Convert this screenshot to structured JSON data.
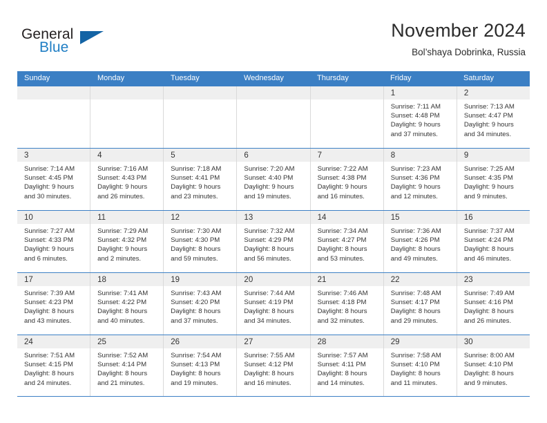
{
  "logo": {
    "word_one": "General",
    "word_two": "Blue",
    "triangle_icon": "triangle-icon",
    "brand_blue": "#1f7ec4",
    "brand_dark_blue": "#1464a5"
  },
  "header": {
    "month_title": "November 2024",
    "location": "Bol’shaya Dobrinka, Russia"
  },
  "colors": {
    "header_band": "#3b7fc4",
    "day_band": "#efefef",
    "cell_border": "#d9d9d9",
    "text": "#333333"
  },
  "weekdays": [
    "Sunday",
    "Monday",
    "Tuesday",
    "Wednesday",
    "Thursday",
    "Friday",
    "Saturday"
  ],
  "weeks": [
    [
      {
        "day": "",
        "sunrise": "",
        "sunset": "",
        "daylight_1": "",
        "daylight_2": ""
      },
      {
        "day": "",
        "sunrise": "",
        "sunset": "",
        "daylight_1": "",
        "daylight_2": ""
      },
      {
        "day": "",
        "sunrise": "",
        "sunset": "",
        "daylight_1": "",
        "daylight_2": ""
      },
      {
        "day": "",
        "sunrise": "",
        "sunset": "",
        "daylight_1": "",
        "daylight_2": ""
      },
      {
        "day": "",
        "sunrise": "",
        "sunset": "",
        "daylight_1": "",
        "daylight_2": ""
      },
      {
        "day": "1",
        "sunrise": "Sunrise: 7:11 AM",
        "sunset": "Sunset: 4:48 PM",
        "daylight_1": "Daylight: 9 hours",
        "daylight_2": "and 37 minutes."
      },
      {
        "day": "2",
        "sunrise": "Sunrise: 7:13 AM",
        "sunset": "Sunset: 4:47 PM",
        "daylight_1": "Daylight: 9 hours",
        "daylight_2": "and 34 minutes."
      }
    ],
    [
      {
        "day": "3",
        "sunrise": "Sunrise: 7:14 AM",
        "sunset": "Sunset: 4:45 PM",
        "daylight_1": "Daylight: 9 hours",
        "daylight_2": "and 30 minutes."
      },
      {
        "day": "4",
        "sunrise": "Sunrise: 7:16 AM",
        "sunset": "Sunset: 4:43 PM",
        "daylight_1": "Daylight: 9 hours",
        "daylight_2": "and 26 minutes."
      },
      {
        "day": "5",
        "sunrise": "Sunrise: 7:18 AM",
        "sunset": "Sunset: 4:41 PM",
        "daylight_1": "Daylight: 9 hours",
        "daylight_2": "and 23 minutes."
      },
      {
        "day": "6",
        "sunrise": "Sunrise: 7:20 AM",
        "sunset": "Sunset: 4:40 PM",
        "daylight_1": "Daylight: 9 hours",
        "daylight_2": "and 19 minutes."
      },
      {
        "day": "7",
        "sunrise": "Sunrise: 7:22 AM",
        "sunset": "Sunset: 4:38 PM",
        "daylight_1": "Daylight: 9 hours",
        "daylight_2": "and 16 minutes."
      },
      {
        "day": "8",
        "sunrise": "Sunrise: 7:23 AM",
        "sunset": "Sunset: 4:36 PM",
        "daylight_1": "Daylight: 9 hours",
        "daylight_2": "and 12 minutes."
      },
      {
        "day": "9",
        "sunrise": "Sunrise: 7:25 AM",
        "sunset": "Sunset: 4:35 PM",
        "daylight_1": "Daylight: 9 hours",
        "daylight_2": "and 9 minutes."
      }
    ],
    [
      {
        "day": "10",
        "sunrise": "Sunrise: 7:27 AM",
        "sunset": "Sunset: 4:33 PM",
        "daylight_1": "Daylight: 9 hours",
        "daylight_2": "and 6 minutes."
      },
      {
        "day": "11",
        "sunrise": "Sunrise: 7:29 AM",
        "sunset": "Sunset: 4:32 PM",
        "daylight_1": "Daylight: 9 hours",
        "daylight_2": "and 2 minutes."
      },
      {
        "day": "12",
        "sunrise": "Sunrise: 7:30 AM",
        "sunset": "Sunset: 4:30 PM",
        "daylight_1": "Daylight: 8 hours",
        "daylight_2": "and 59 minutes."
      },
      {
        "day": "13",
        "sunrise": "Sunrise: 7:32 AM",
        "sunset": "Sunset: 4:29 PM",
        "daylight_1": "Daylight: 8 hours",
        "daylight_2": "and 56 minutes."
      },
      {
        "day": "14",
        "sunrise": "Sunrise: 7:34 AM",
        "sunset": "Sunset: 4:27 PM",
        "daylight_1": "Daylight: 8 hours",
        "daylight_2": "and 53 minutes."
      },
      {
        "day": "15",
        "sunrise": "Sunrise: 7:36 AM",
        "sunset": "Sunset: 4:26 PM",
        "daylight_1": "Daylight: 8 hours",
        "daylight_2": "and 49 minutes."
      },
      {
        "day": "16",
        "sunrise": "Sunrise: 7:37 AM",
        "sunset": "Sunset: 4:24 PM",
        "daylight_1": "Daylight: 8 hours",
        "daylight_2": "and 46 minutes."
      }
    ],
    [
      {
        "day": "17",
        "sunrise": "Sunrise: 7:39 AM",
        "sunset": "Sunset: 4:23 PM",
        "daylight_1": "Daylight: 8 hours",
        "daylight_2": "and 43 minutes."
      },
      {
        "day": "18",
        "sunrise": "Sunrise: 7:41 AM",
        "sunset": "Sunset: 4:22 PM",
        "daylight_1": "Daylight: 8 hours",
        "daylight_2": "and 40 minutes."
      },
      {
        "day": "19",
        "sunrise": "Sunrise: 7:43 AM",
        "sunset": "Sunset: 4:20 PM",
        "daylight_1": "Daylight: 8 hours",
        "daylight_2": "and 37 minutes."
      },
      {
        "day": "20",
        "sunrise": "Sunrise: 7:44 AM",
        "sunset": "Sunset: 4:19 PM",
        "daylight_1": "Daylight: 8 hours",
        "daylight_2": "and 34 minutes."
      },
      {
        "day": "21",
        "sunrise": "Sunrise: 7:46 AM",
        "sunset": "Sunset: 4:18 PM",
        "daylight_1": "Daylight: 8 hours",
        "daylight_2": "and 32 minutes."
      },
      {
        "day": "22",
        "sunrise": "Sunrise: 7:48 AM",
        "sunset": "Sunset: 4:17 PM",
        "daylight_1": "Daylight: 8 hours",
        "daylight_2": "and 29 minutes."
      },
      {
        "day": "23",
        "sunrise": "Sunrise: 7:49 AM",
        "sunset": "Sunset: 4:16 PM",
        "daylight_1": "Daylight: 8 hours",
        "daylight_2": "and 26 minutes."
      }
    ],
    [
      {
        "day": "24",
        "sunrise": "Sunrise: 7:51 AM",
        "sunset": "Sunset: 4:15 PM",
        "daylight_1": "Daylight: 8 hours",
        "daylight_2": "and 24 minutes."
      },
      {
        "day": "25",
        "sunrise": "Sunrise: 7:52 AM",
        "sunset": "Sunset: 4:14 PM",
        "daylight_1": "Daylight: 8 hours",
        "daylight_2": "and 21 minutes."
      },
      {
        "day": "26",
        "sunrise": "Sunrise: 7:54 AM",
        "sunset": "Sunset: 4:13 PM",
        "daylight_1": "Daylight: 8 hours",
        "daylight_2": "and 19 minutes."
      },
      {
        "day": "27",
        "sunrise": "Sunrise: 7:55 AM",
        "sunset": "Sunset: 4:12 PM",
        "daylight_1": "Daylight: 8 hours",
        "daylight_2": "and 16 minutes."
      },
      {
        "day": "28",
        "sunrise": "Sunrise: 7:57 AM",
        "sunset": "Sunset: 4:11 PM",
        "daylight_1": "Daylight: 8 hours",
        "daylight_2": "and 14 minutes."
      },
      {
        "day": "29",
        "sunrise": "Sunrise: 7:58 AM",
        "sunset": "Sunset: 4:10 PM",
        "daylight_1": "Daylight: 8 hours",
        "daylight_2": "and 11 minutes."
      },
      {
        "day": "30",
        "sunrise": "Sunrise: 8:00 AM",
        "sunset": "Sunset: 4:10 PM",
        "daylight_1": "Daylight: 8 hours",
        "daylight_2": "and 9 minutes."
      }
    ]
  ]
}
